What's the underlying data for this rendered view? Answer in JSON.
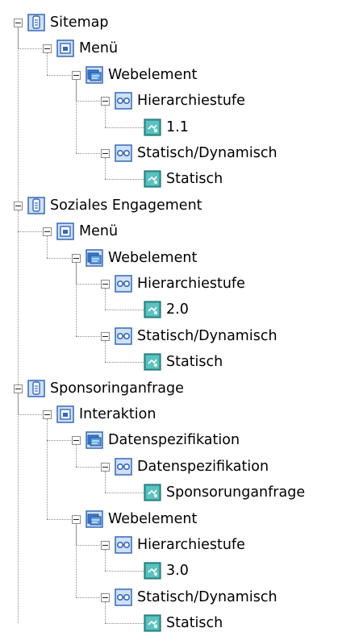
{
  "tree": {
    "nodes": [
      {
        "label": "Sitemap",
        "icon": "page-icon",
        "depth": 0,
        "expandable": true
      },
      {
        "label": "Menü",
        "icon": "menu-icon",
        "depth": 1,
        "expandable": true
      },
      {
        "label": "Webelement",
        "icon": "webelement-icon",
        "depth": 2,
        "expandable": true
      },
      {
        "label": "Hierarchiestufe",
        "icon": "attribute-icon",
        "depth": 3,
        "expandable": true
      },
      {
        "label": "1.1",
        "icon": "value-icon",
        "depth": 4,
        "expandable": false
      },
      {
        "label": "Statisch/Dynamisch",
        "icon": "attribute-icon",
        "depth": 3,
        "expandable": true
      },
      {
        "label": "Statisch",
        "icon": "value-icon",
        "depth": 4,
        "expandable": false
      },
      {
        "label": "Soziales Engagement",
        "icon": "page-icon",
        "depth": 0,
        "expandable": true
      },
      {
        "label": "Menü",
        "icon": "menu-icon",
        "depth": 1,
        "expandable": true
      },
      {
        "label": "Webelement",
        "icon": "webelement-icon",
        "depth": 2,
        "expandable": true
      },
      {
        "label": "Hierarchiestufe",
        "icon": "attribute-icon",
        "depth": 3,
        "expandable": true
      },
      {
        "label": "2.0",
        "icon": "value-icon",
        "depth": 4,
        "expandable": false
      },
      {
        "label": "Statisch/Dynamisch",
        "icon": "attribute-icon",
        "depth": 3,
        "expandable": true
      },
      {
        "label": "Statisch",
        "icon": "value-icon",
        "depth": 4,
        "expandable": false
      },
      {
        "label": "Sponsoringanfrage",
        "icon": "page-icon",
        "depth": 0,
        "expandable": true
      },
      {
        "label": "Interaktion",
        "icon": "menu-icon",
        "depth": 1,
        "expandable": true
      },
      {
        "label": "Datenspezifikation",
        "icon": "webelement-icon",
        "depth": 2,
        "expandable": true
      },
      {
        "label": "Datenspezifikation",
        "icon": "attribute-icon",
        "depth": 3,
        "expandable": true
      },
      {
        "label": "Sponsorunganfrage",
        "icon": "value-icon",
        "depth": 4,
        "expandable": false
      },
      {
        "label": "Webelement",
        "icon": "webelement-icon",
        "depth": 2,
        "expandable": true
      },
      {
        "label": "Hierarchiestufe",
        "icon": "attribute-icon",
        "depth": 3,
        "expandable": true
      },
      {
        "label": "3.0",
        "icon": "value-icon",
        "depth": 4,
        "expandable": false
      },
      {
        "label": "Statisch/Dynamisch",
        "icon": "attribute-icon",
        "depth": 3,
        "expandable": true
      },
      {
        "label": "Statisch",
        "icon": "value-icon",
        "depth": 4,
        "expandable": false
      }
    ]
  },
  "colors": {
    "icon_border": "#3568b8",
    "icon_fill": "#cfe0f7",
    "value_icon": "#3aa3a0",
    "connector": "#8c8c8c"
  }
}
